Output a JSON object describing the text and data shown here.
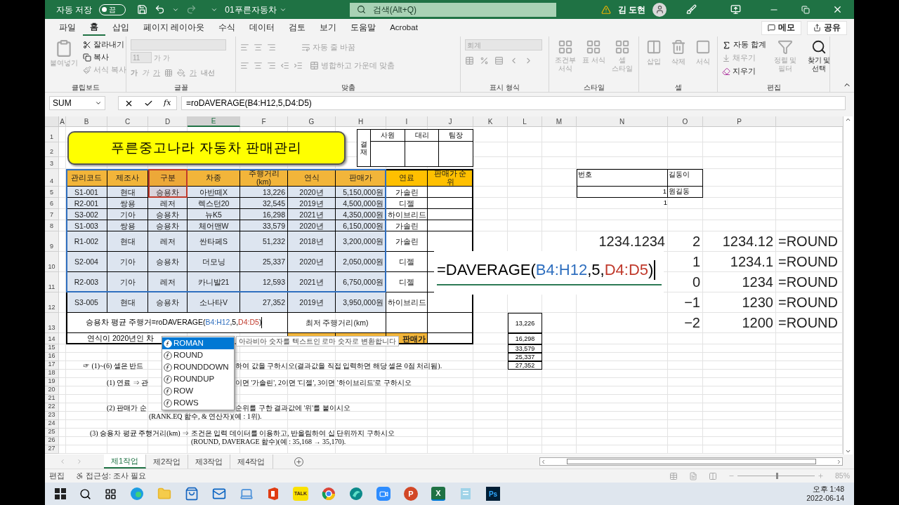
{
  "title_bar": {
    "autosave_label": "자동 저장",
    "autosave_state": "끔",
    "autosave_on": false,
    "file_title": "01푸른자동차",
    "search_placeholder": "검색(Alt+Q)",
    "user_name": "김 도현"
  },
  "menu_tabs": [
    {
      "label": "파일",
      "selected": false
    },
    {
      "label": "홈",
      "selected": true
    },
    {
      "label": "삽입",
      "selected": false
    },
    {
      "label": "페이지 레이아웃",
      "selected": false
    },
    {
      "label": "수식",
      "selected": false
    },
    {
      "label": "데이터",
      "selected": false
    },
    {
      "label": "검토",
      "selected": false
    },
    {
      "label": "보기",
      "selected": false
    },
    {
      "label": "도움말",
      "selected": false
    },
    {
      "label": "Acrobat",
      "selected": false
    }
  ],
  "ribbon_buttons": {
    "memo": "메모",
    "share": "공유"
  },
  "clipboard": {
    "title": "클립보드",
    "paste": {
      "label": "붙여넣기",
      "disabled": true
    },
    "cut": {
      "label": "잘라내기",
      "disabled": false
    },
    "copy": {
      "label": "복사",
      "disabled": false
    },
    "format_painter": {
      "label": "서식 복사",
      "disabled": true
    }
  },
  "font": {
    "title": "글꼴",
    "size": "11",
    "grow": "가",
    "shrink": "가",
    "bold": "가",
    "italic": "가",
    "underline": "가",
    "font_color": "가",
    "phonetic": "내선"
  },
  "alignment": {
    "title": "맞춤",
    "wrap": "자동 줄 바꿈",
    "merge": "병합하고 가운데 맞춤"
  },
  "number": {
    "title": "표시 형식",
    "format": "회계"
  },
  "styles": {
    "title": "스타일",
    "items": [
      "조건부 서식",
      "표 서식",
      "셀 스타일"
    ]
  },
  "cells": {
    "title": "셀",
    "items": [
      "삽입",
      "삭제",
      "서식"
    ]
  },
  "editing": {
    "title": "편집",
    "autosum": {
      "label": "자동 합계",
      "disabled": false
    },
    "fill": {
      "label": "채우기",
      "disabled": true
    },
    "clear": {
      "label": "지우기",
      "disabled": false
    },
    "sort": {
      "label": "정렬 및 필터",
      "disabled": true
    },
    "find": {
      "label": "찾기 및 선택",
      "disabled": false
    }
  },
  "formula_bar": {
    "name_box": "SUM",
    "fx": "fx",
    "formula": "=roDAVERAGE(B4:H12,5,D4:D5)"
  },
  "sheet": {
    "columns": [
      {
        "label": "A",
        "selected": false
      },
      {
        "label": "B",
        "selected": false
      },
      {
        "label": "C",
        "selected": false
      },
      {
        "label": "D",
        "selected": false
      },
      {
        "label": "E",
        "selected": true
      },
      {
        "label": "F",
        "selected": false
      },
      {
        "label": "G",
        "selected": false
      },
      {
        "label": "H",
        "selected": false
      },
      {
        "label": "I",
        "selected": false
      },
      {
        "label": "J",
        "selected": false
      },
      {
        "label": "K",
        "selected": false
      },
      {
        "label": "L",
        "selected": false
      },
      {
        "label": "M",
        "selected": false
      },
      {
        "label": "N",
        "selected": false
      },
      {
        "label": "O",
        "selected": false
      },
      {
        "label": "P",
        "selected": false
      }
    ],
    "rows": [
      "1",
      "2",
      "3",
      "4",
      "5",
      "6",
      "7",
      "8",
      "9",
      "10",
      "11",
      "12",
      "13",
      "14",
      "15",
      "16",
      "17",
      "18",
      "19",
      "20",
      "21",
      "22",
      "23",
      "24",
      "25",
      "26",
      "27"
    ]
  },
  "banner": "푸른중고나라 자동차 판매관리",
  "approval": {
    "label": "결재",
    "roles": [
      "사원",
      "대리",
      "팀장"
    ]
  },
  "table": {
    "columns": [
      "관리코드",
      "제조사",
      "구분",
      "차종",
      "주행거리 (km)",
      "연식",
      "판매가",
      "연료",
      "판매가 순위"
    ],
    "rows": [
      [
        "S1-001",
        "현대",
        "승용차",
        "아반떼X",
        "13,226",
        "2020년",
        "5,150,000원",
        "가솔린"
      ],
      [
        "R2-001",
        "쌍용",
        "레저",
        "렉스턴20",
        "32,545",
        "2019년",
        "4,500,000원",
        "디젤"
      ],
      [
        "S3-002",
        "기아",
        "승용차",
        "뉴K5",
        "16,298",
        "2021년",
        "4,350,000원",
        "하이브리드"
      ],
      [
        "S1-003",
        "쌍용",
        "승용차",
        "체어맨W",
        "33,579",
        "2020년",
        "6,150,000원",
        "가솔린"
      ],
      [
        "R1-002",
        "현대",
        "레저",
        "싼타페S",
        "51,232",
        "2018년",
        "3,200,000원",
        "가솔린"
      ],
      [
        "S2-004",
        "기아",
        "승용차",
        "더모닝",
        "25,337",
        "2020년",
        "2,050,000원",
        "디젤"
      ],
      [
        "R2-003",
        "기아",
        "레저",
        "카니발21",
        "12,593",
        "2021년",
        "6,750,000원",
        "디젤"
      ],
      [
        "S3-005",
        "현대",
        "승용차",
        "소나타V",
        "27,352",
        "2019년",
        "3,950,000원",
        "하이브리드"
      ]
    ],
    "avg_label": "승용차 평균 주행거",
    "editing_formula": [
      {
        "text": "=roDAVERAGE("
      },
      {
        "text": "B4:H12",
        "color": "#2f6fbf"
      },
      {
        "text": ",5,"
      },
      {
        "text": "D4:D5",
        "color": "#c0392b"
      },
      {
        "text": ")"
      }
    ],
    "min_label": "최저 주행거리(km)",
    "year_label": "연식이 2020년인 차",
    "price_label": "판매가"
  },
  "autocomplete": {
    "items": [
      {
        "label": "ROMAN",
        "selected": true
      },
      {
        "label": "ROUND",
        "selected": false
      },
      {
        "label": "ROUNDDOWN",
        "selected": false
      },
      {
        "label": "ROUNDUP",
        "selected": false
      },
      {
        "label": "ROW",
        "selected": false
      },
      {
        "label": "ROWS",
        "selected": false
      }
    ],
    "tooltip": "아라비아 숫자를 텍스트인 로마 숫자로 변환합니다"
  },
  "instructions": [
    {
      "left": "☞ (1)~(6) 셀은 반드",
      "right": "하여 값을 구하시오(결과값을 직접 입력하면 해당 셀은 0점 처리됨)."
    },
    {
      "left": "(1) 연료 ⇒ 관",
      "right": "이면 '가솔린', 2이면 '디젤', 3이면 '하이브리드'로 구하시오"
    },
    {
      "left": "(2) 판매가 순",
      "right": "순위를 구한 결과값에 '위'를 붙이시오"
    },
    {
      "left": "(RANK.EQ 함수, & 연산자)(예 : 1위)."
    },
    {
      "left": "(3) 승용차 평균 주행거리(km) ⇒ 조건은 입력 데이터를 이용하고, 반올림하여 십 단위까지 구하시오"
    },
    {
      "left": "(ROUND, DAVERAGE 함수)(예 : 35,168 → 35,170)."
    }
  ],
  "lookup": {
    "headers": [
      "번호",
      "길동이"
    ],
    "row": [
      "1",
      "원길동"
    ],
    "below": "1"
  },
  "round_examples": {
    "value": "1234.1234",
    "rows": [
      {
        "digits": "2",
        "result": "1234.12",
        "formula": "=ROUND"
      },
      {
        "digits": "1",
        "result": "1234.1",
        "formula": "=ROUND"
      },
      {
        "digits": "0",
        "result": "1234",
        "formula": "=ROUND"
      },
      {
        "digits": "−1",
        "result": "1230",
        "formula": "=ROUND"
      },
      {
        "digits": "−2",
        "result": "1200",
        "formula": "=ROUND"
      }
    ]
  },
  "distances": [
    "13,226",
    "16,298",
    "33,579",
    "25,337",
    "27,352"
  ],
  "zoom_overlay": [
    {
      "text": "=DAVERAGE(",
      "color": "#000000"
    },
    {
      "text": "B4:H12",
      "color": "#2f6fbf"
    },
    {
      "text": ",5,",
      "color": "#000000"
    },
    {
      "text": "D4:D5",
      "color": "#c0392b"
    },
    {
      "text": ")",
      "color": "#000000"
    }
  ],
  "sheet_tabs": [
    {
      "label": "제1작업",
      "selected": true
    },
    {
      "label": "제2작업",
      "selected": false
    },
    {
      "label": "제3작업",
      "selected": false
    },
    {
      "label": "제4작업",
      "selected": false
    }
  ],
  "status_bar": {
    "mode": "편집",
    "accessibility": "접근성: 조사 필요",
    "zoom": "85%",
    "zoom_level": {
      "level": 0.5
    }
  },
  "taskbar": {
    "talk": "TALK",
    "powerpoint": "P",
    "excel": "X",
    "photoshop": "Ps",
    "time": "오후 1:48",
    "date": "2022-06-14"
  }
}
